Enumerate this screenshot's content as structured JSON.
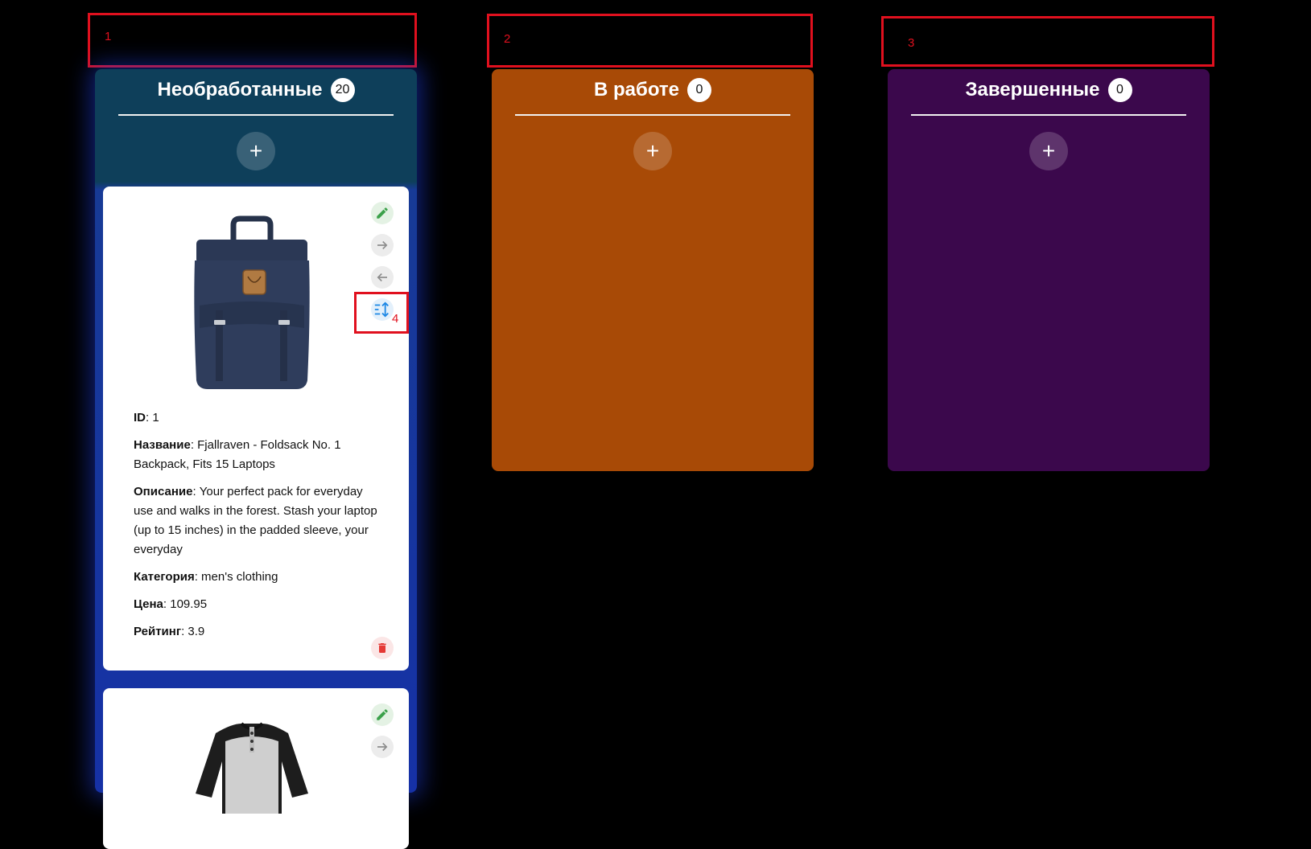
{
  "annotations": [
    "1",
    "2",
    "3",
    "4"
  ],
  "columns": [
    {
      "title": "Необработанные",
      "count": "20",
      "add": "+"
    },
    {
      "title": "В работе",
      "count": "0",
      "add": "+"
    },
    {
      "title": "Завершенные",
      "count": "0",
      "add": "+"
    }
  ],
  "card": {
    "id_label": "ID",
    "id_value": ": 1",
    "name_label": "Название",
    "name_value": ": Fjallraven - Foldsack No. 1 Backpack, Fits 15 Laptops",
    "desc_label": "Описание",
    "desc_value": ": Your perfect pack for everyday use and walks in the forest. Stash your laptop (up to 15 inches) in the padded sleeve, your everyday",
    "cat_label": "Категория",
    "cat_value": ": men's clothing",
    "price_label": "Цена",
    "price_value": ": 109.95",
    "rating_label": "Рейтинг",
    "rating_value": ": 3.9"
  },
  "icons": {
    "edit": "pencil-icon",
    "forward": "arrow-right-icon",
    "back": "arrow-left-icon",
    "sort": "sort-icon",
    "delete": "trash-icon"
  },
  "colors": {
    "column_new": "#0e3f5a",
    "column_in_progress": "#a84a06",
    "column_done": "#3b084c",
    "edit_green": "#3ba14a",
    "delete_red": "#e53935",
    "sort_blue": "#1e88e5",
    "annotation_red": "#e0101e"
  }
}
